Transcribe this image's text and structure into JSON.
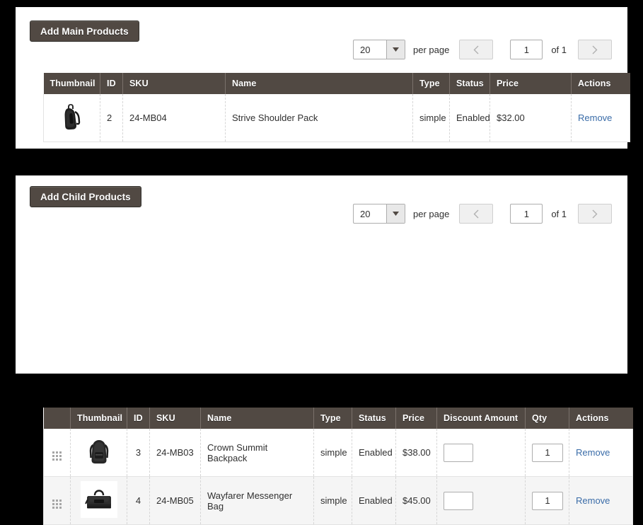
{
  "theme": {
    "header_bg": "#514943",
    "button_bg": "#514943",
    "link_color": "#3a6ca8",
    "page_bg": "#000000",
    "panel_bg": "#ffffff"
  },
  "main_panel": {
    "add_button_label": "Add Main Products",
    "pager": {
      "per_page_value": "20",
      "per_page_label": "per page",
      "prev_icon": "chevron-left-icon",
      "next_icon": "chevron-right-icon",
      "page_value": "1",
      "of_label": "of 1"
    },
    "columns": [
      "Thumbnail",
      "ID",
      "SKU",
      "Name",
      "Type",
      "Status",
      "Price",
      "Actions"
    ],
    "rows": [
      {
        "thumbnail": "strive-shoulder-pack-thumbnail",
        "id": "2",
        "sku": "24-MB04",
        "name": "Strive Shoulder Pack",
        "type": "simple",
        "status": "Enabled",
        "price": "$32.00",
        "action": "Remove"
      }
    ]
  },
  "child_panel": {
    "add_button_label": "Add Child Products",
    "pager": {
      "per_page_value": "20",
      "per_page_label": "per page",
      "prev_icon": "chevron-left-icon",
      "next_icon": "chevron-right-icon",
      "page_value": "1",
      "of_label": "of 1"
    },
    "columns": [
      "",
      "Thumbnail",
      "ID",
      "SKU",
      "Name",
      "Type",
      "Status",
      "Price",
      "Discount Amount",
      "Qty",
      "Actions"
    ],
    "rows": [
      {
        "handle": "drag-handle-icon",
        "thumbnail": "crown-summit-backpack-thumbnail",
        "id": "3",
        "sku": "24-MB03",
        "name": "Crown Summit Backpack",
        "type": "simple",
        "status": "Enabled",
        "price": "$38.00",
        "discount_amount": "",
        "qty": "1",
        "action": "Remove"
      },
      {
        "handle": "drag-handle-icon",
        "thumbnail": "wayfarer-messenger-bag-thumbnail",
        "id": "4",
        "sku": "24-MB05",
        "name": "Wayfarer Messenger Bag",
        "type": "simple",
        "status": "Enabled",
        "price": "$45.00",
        "discount_amount": "",
        "qty": "1",
        "action": "Remove"
      }
    ]
  }
}
